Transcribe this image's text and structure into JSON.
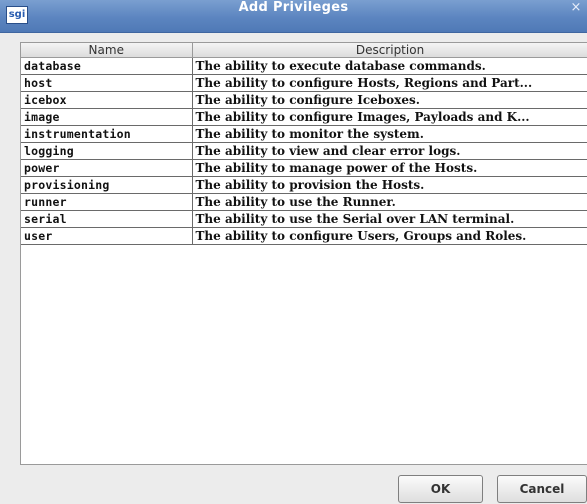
{
  "window": {
    "title": "Add Privileges",
    "logo_text": "sgi",
    "close_glyph": "×"
  },
  "table": {
    "columns": [
      "Name",
      "Description"
    ],
    "rows": [
      {
        "name": "database",
        "description": "The ability to execute database commands."
      },
      {
        "name": "host",
        "description": "The ability to configure Hosts, Regions and Part..."
      },
      {
        "name": "icebox",
        "description": "The ability to configure Iceboxes."
      },
      {
        "name": "image",
        "description": "The ability to configure Images, Payloads and K..."
      },
      {
        "name": "instrumentation",
        "description": "The ability to monitor the system."
      },
      {
        "name": "logging",
        "description": "The ability to view and clear error logs."
      },
      {
        "name": "power",
        "description": "The ability to manage power of the Hosts."
      },
      {
        "name": "provisioning",
        "description": "The ability to provision the Hosts."
      },
      {
        "name": "runner",
        "description": "The ability to use the Runner."
      },
      {
        "name": "serial",
        "description": "The ability to use the Serial over LAN terminal."
      },
      {
        "name": "user",
        "description": "The ability to configure Users, Groups and Roles."
      }
    ]
  },
  "buttons": {
    "ok": "OK",
    "cancel": "Cancel"
  },
  "colors": {
    "titlebar": "#5c85c0",
    "title_text": "#ffffff"
  }
}
